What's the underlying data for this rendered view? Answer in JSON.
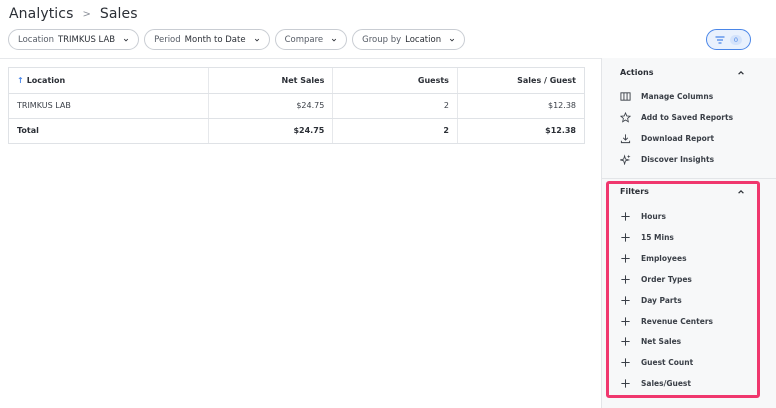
{
  "breadcrumb": {
    "root": "Analytics",
    "current": "Sales"
  },
  "filters": {
    "location": {
      "label": "Location",
      "value": "TRIMKUS LAB"
    },
    "period": {
      "label": "Period",
      "value": "Month to Date"
    },
    "compare": {
      "label": "Compare"
    },
    "group_by": {
      "label": "Group by",
      "value": "Location"
    },
    "active_count": "0"
  },
  "table": {
    "headers": [
      "Location",
      "Net Sales",
      "Guests",
      "Sales / Guest"
    ],
    "rows": [
      [
        "TRIMKUS LAB",
        "$24.75",
        "2",
        "$12.38"
      ]
    ],
    "total": [
      "Total",
      "$24.75",
      "2",
      "$12.38"
    ]
  },
  "actions": {
    "title": "Actions",
    "items": [
      {
        "label": "Manage Columns",
        "icon": "columns-icon"
      },
      {
        "label": "Add to Saved Reports",
        "icon": "star-icon"
      },
      {
        "label": "Download Report",
        "icon": "download-icon"
      },
      {
        "label": "Discover Insights",
        "icon": "sparkle-icon"
      }
    ]
  },
  "filters_panel": {
    "title": "Filters",
    "items": [
      {
        "label": "Hours"
      },
      {
        "label": "15 Mins"
      },
      {
        "label": "Employees"
      },
      {
        "label": "Order Types"
      },
      {
        "label": "Day Parts"
      },
      {
        "label": "Revenue Centers"
      },
      {
        "label": "Net Sales"
      },
      {
        "label": "Guest Count"
      },
      {
        "label": "Sales/Guest"
      }
    ]
  },
  "colors": {
    "accent": "#4a86e8",
    "highlight": "#f0376e"
  }
}
